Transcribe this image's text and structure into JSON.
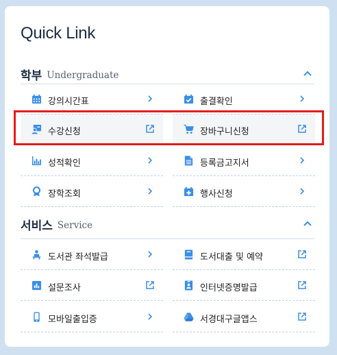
{
  "title": "Quick Link",
  "sections": [
    {
      "ko": "학부",
      "en": "Undergraduate",
      "items": [
        {
          "label": "강의시간표",
          "icon": "calendar-icon",
          "action": "chevron"
        },
        {
          "label": "출결확인",
          "icon": "calendar-check-icon",
          "action": "chevron"
        },
        {
          "label": "수강신청",
          "icon": "person-board-icon",
          "action": "external"
        },
        {
          "label": "장바구니신청",
          "icon": "cart-icon",
          "action": "external"
        },
        {
          "label": "성적확인",
          "icon": "bar-chart-icon",
          "action": "chevron"
        },
        {
          "label": "등록금고지서",
          "icon": "document-icon",
          "action": "chevron"
        },
        {
          "label": "장학조회",
          "icon": "award-icon",
          "action": "chevron"
        },
        {
          "label": "행사신청",
          "icon": "calendar-plus-icon",
          "action": "chevron"
        }
      ]
    },
    {
      "ko": "서비스",
      "en": "Service",
      "items": [
        {
          "label": "도서관 좌석발급",
          "icon": "seat-icon",
          "action": "chevron"
        },
        {
          "label": "도서대출 및 예약",
          "icon": "book-icon",
          "action": "external"
        },
        {
          "label": "설문조사",
          "icon": "survey-chart-icon",
          "action": "external"
        },
        {
          "label": "인터넷증명발급",
          "icon": "id-card-icon",
          "action": "external"
        },
        {
          "label": "모바일출입증",
          "icon": "mobile-icon",
          "action": "chevron"
        },
        {
          "label": "서경대구글앱스",
          "icon": "google-drive-icon",
          "action": "external"
        }
      ]
    }
  ],
  "colors": {
    "accent": "#3a8ee6",
    "highlight": "#e31b1b",
    "background": "#cfe0f1"
  }
}
